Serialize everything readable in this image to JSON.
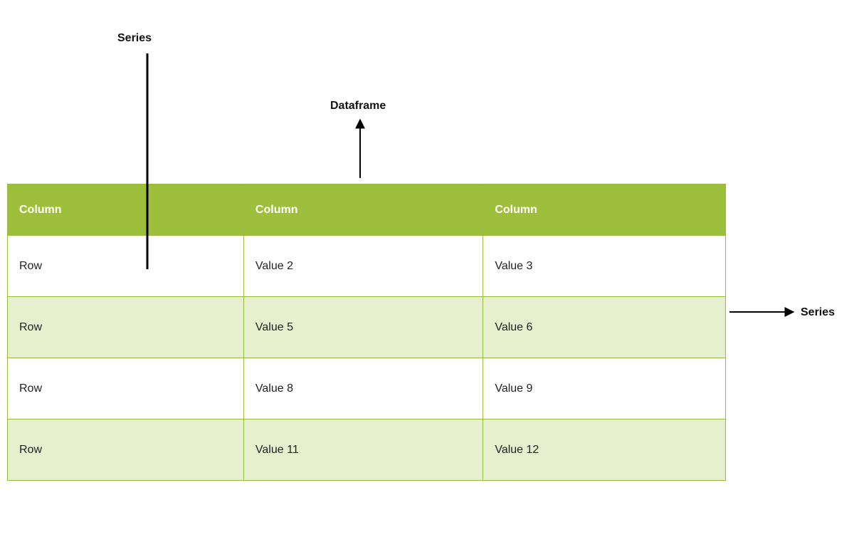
{
  "labels": {
    "series_top": "Series",
    "dataframe": "Dataframe",
    "series_right": "Series"
  },
  "table": {
    "headers": [
      "Column",
      "Column",
      "Column"
    ],
    "rows": [
      [
        "Row",
        "Value 2",
        "Value 3"
      ],
      [
        "Row",
        "Value 5",
        "Value 6"
      ],
      [
        "Row",
        "Value 8",
        "Value 9"
      ],
      [
        "Row",
        "Value 11",
        "Value 12"
      ]
    ]
  },
  "colors": {
    "header_bg": "#9ebf3b",
    "row_alt_bg": "#e6efce",
    "border": "#97bb3c"
  }
}
